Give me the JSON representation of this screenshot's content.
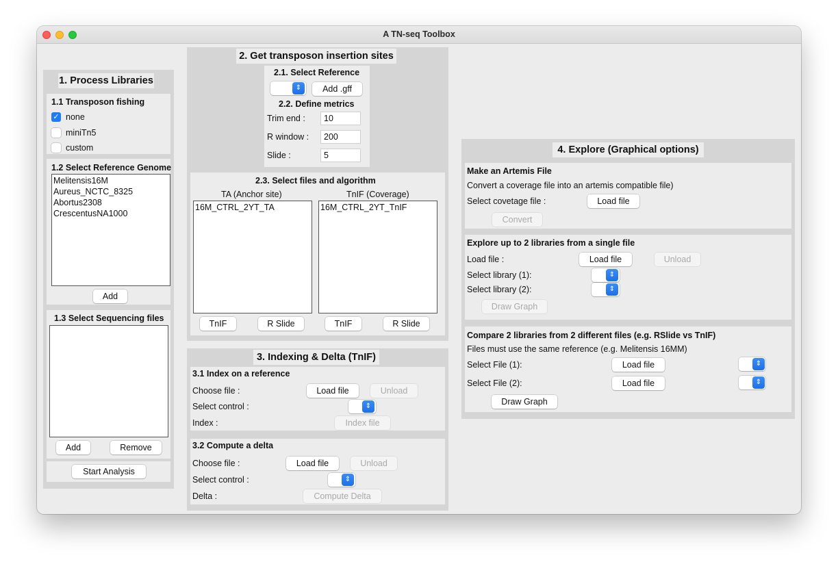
{
  "window": {
    "title": "A TN-seq Toolbox"
  },
  "section1": {
    "title": "1. Process Libraries",
    "fishing": {
      "title": "1.1 Transposon fishing",
      "options": [
        {
          "label": "none",
          "checked": true
        },
        {
          "label": "miniTn5",
          "checked": false
        },
        {
          "label": "custom",
          "checked": false
        }
      ]
    },
    "genome": {
      "title": "1.2 Select Reference Genome",
      "items": [
        "Melitensis16M",
        "Aureus_NCTC_8325",
        "Abortus2308",
        "CrescentusNA1000"
      ],
      "add_label": "Add"
    },
    "seqfiles": {
      "title": "1.3 Select Sequencing files",
      "add_label": "Add",
      "remove_label": "Remove"
    },
    "start_label": "Start Analysis"
  },
  "section2": {
    "title": "2. Get transposon  insertion sites",
    "reference": {
      "title": "2.1. Select Reference",
      "add_gff_label": "Add .gff"
    },
    "metrics": {
      "title": "2.2. Define metrics",
      "trim_label": "Trim end :",
      "trim_value": "10",
      "rwindow_label": "R window :",
      "rwindow_value": "200",
      "slide_label": "Slide :",
      "slide_value": "5"
    },
    "files": {
      "title": "2.3. Select files and algorithm",
      "ta_header": "TA (Anchor site)",
      "tnif_header": "TnIF (Coverage)",
      "ta_items": [
        "16M_CTRL_2YT_TA"
      ],
      "tnif_items": [
        "16M_CTRL_2YT_TnIF"
      ],
      "btn_tnif": "TnIF",
      "btn_rslide": "R Slide"
    }
  },
  "section3": {
    "title": "3. Indexing & Delta (TnIF)",
    "index": {
      "title": "3.1 Index on a reference",
      "choose_label": "Choose file :",
      "load_label": "Load file",
      "unload_label": "Unload",
      "control_label": "Select control :",
      "index_label": "Index :",
      "index_btn": "Index file"
    },
    "delta": {
      "title": "3.2 Compute a delta",
      "choose_label": "Choose file :",
      "load_label": "Load file",
      "unload_label": "Unload",
      "control_label": "Select control :",
      "delta_label": "Delta :",
      "delta_btn": "Compute Delta"
    }
  },
  "section4": {
    "title": "4. Explore (Graphical options)",
    "artemis": {
      "title": "Make an Artemis File",
      "desc": "Convert a coverage file into an artemis compatible file)",
      "select_label": "Select covetage file :",
      "load_label": "Load file",
      "convert_label": "Convert"
    },
    "explore": {
      "title": "Explore up to 2 libraries from a single file",
      "load_label_text": "Load file :",
      "load_label": "Load file",
      "unload_label": "Unload",
      "lib1_label": "Select library (1):",
      "lib2_label": "Select library (2):",
      "draw_label": "Draw Graph"
    },
    "compare": {
      "title": "Compare 2 libraries from 2 different files (e.g. RSlide vs TnIF)",
      "desc": "Files must use the same reference (e.g. Melitensis 16MM)",
      "file1_label": "Select File (1):",
      "file2_label": "Select File (2):",
      "load_label": "Load file",
      "draw_label": "Draw Graph"
    }
  },
  "colors": {
    "accent": "#1f7cf5",
    "panel": "#d5d5d5",
    "window": "#ececec"
  }
}
